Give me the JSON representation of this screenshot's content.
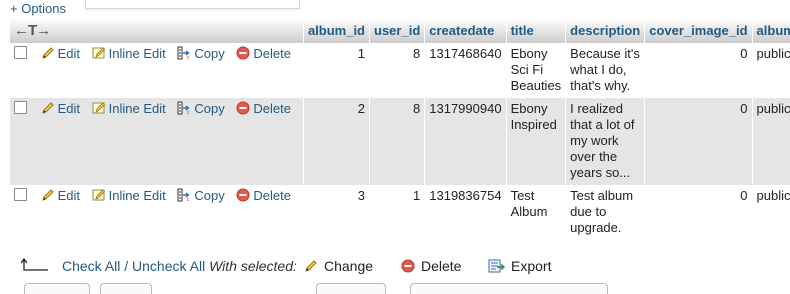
{
  "options_label": "+ Options",
  "header_arrows": "←T→",
  "columns": [
    "album_id",
    "user_id",
    "createdate",
    "title",
    "description",
    "cover_image_id",
    "album_"
  ],
  "row_actions": {
    "edit": "Edit",
    "inline_edit": "Inline Edit",
    "copy": "Copy",
    "delete": "Delete"
  },
  "rows": [
    {
      "album_id": "1",
      "user_id": "8",
      "createdate": "1317468640",
      "title_lines": [
        "Ebony",
        "Sci Fi",
        "Beauties"
      ],
      "description_lines": [
        "Because it's",
        "what I do,",
        "that's why."
      ],
      "cover_image_id": "0",
      "album_type": "public"
    },
    {
      "album_id": "2",
      "user_id": "8",
      "createdate": "1317990940",
      "title_lines": [
        "Ebony",
        "Inspired"
      ],
      "description_lines": [
        "I realized",
        "that a lot of",
        "my work",
        "over the",
        "years so..."
      ],
      "cover_image_id": "0",
      "album_type": "public"
    },
    {
      "album_id": "3",
      "user_id": "1",
      "createdate": "1319836754",
      "title_lines": [
        "Test",
        "Album"
      ],
      "description_lines": [
        "Test album",
        "due to",
        "upgrade."
      ],
      "cover_image_id": "0",
      "album_type": "public"
    }
  ],
  "footer": {
    "check_all": "Check All",
    "separator": "/",
    "uncheck_all": "Uncheck All",
    "with_selected": "With selected:",
    "change": "Change",
    "delete": "Delete",
    "export": "Export"
  },
  "colors": {
    "link": "#235a81",
    "row_even": "#e5e5e5",
    "header_bottom": "#cccccc"
  },
  "icons": [
    "pencil-icon",
    "inline-edit-icon",
    "copy-icon",
    "delete-icon",
    "export-icon",
    "select-arrow-icon"
  ]
}
